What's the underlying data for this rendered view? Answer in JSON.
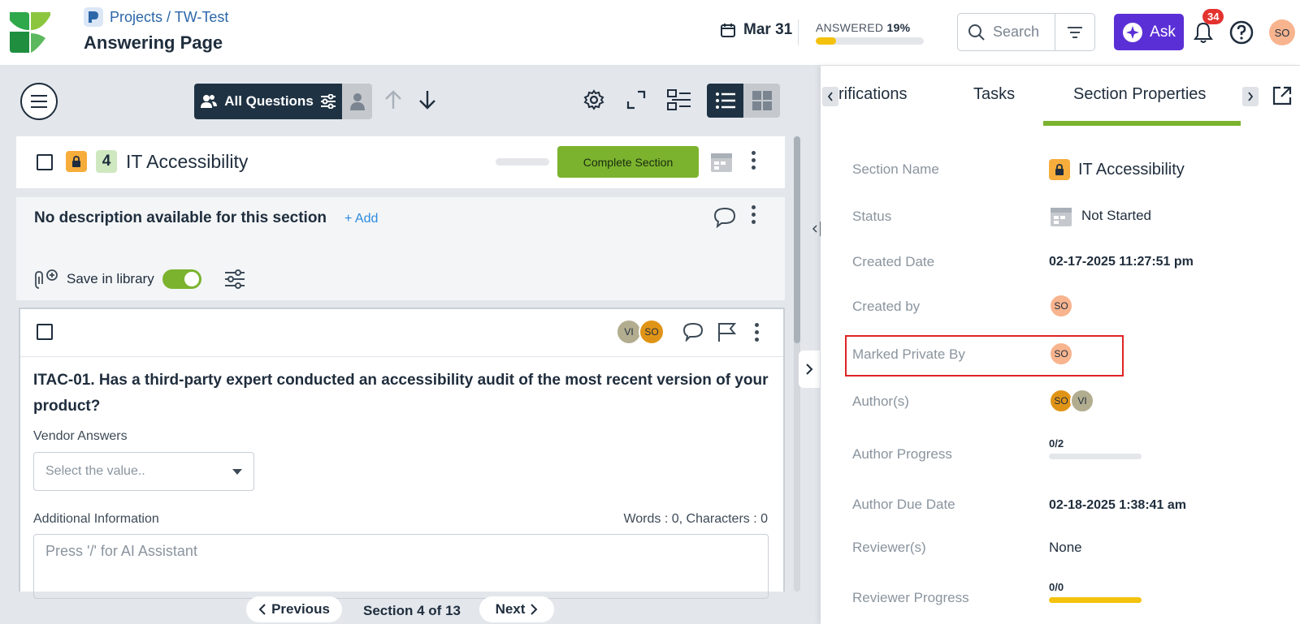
{
  "header": {
    "breadcrumb": "Projects / TW-Test",
    "title": "Answering Page",
    "date": "Mar 31",
    "answered_label": "ANSWERED",
    "answered_percent": "19%",
    "answered_fraction": 0.19,
    "search_placeholder": "Search",
    "ask_label": "Ask",
    "notification_count": "34",
    "user_initials": "SO"
  },
  "toolbar": {
    "filter_label": "All Questions"
  },
  "section": {
    "number": "4",
    "title": "IT Accessibility",
    "complete_label": "Complete Section",
    "description": "No description available for this section",
    "add_label": "+ Add",
    "save_library_label": "Save in library"
  },
  "question": {
    "avatars": [
      "VI",
      "SO"
    ],
    "text": "ITAC-01. Has a third-party expert conducted an accessibility audit of the most recent version of your product?",
    "vendor_label": "Vendor Answers",
    "select_placeholder": "Select the value..",
    "additional_label": "Additional Information",
    "word_count": "Words : 0, Characters : 0",
    "textarea_placeholder": "Press '/' for AI Assistant"
  },
  "footer": {
    "previous": "Previous",
    "section_count": "Section 4 of 13",
    "next": "Next"
  },
  "panel": {
    "tabs": [
      "rifications",
      "Tasks",
      "Section Properties"
    ],
    "active_tab": "Section Properties",
    "rows": {
      "section_name_label": "Section Name",
      "section_name_value": "IT Accessibility",
      "status_label": "Status",
      "status_value": "Not Started",
      "created_date_label": "Created Date",
      "created_date_value": "02-17-2025 11:27:51 pm",
      "created_by_label": "Created by",
      "created_by_value": "SO",
      "marked_private_label": "Marked Private By",
      "marked_private_value": "SO",
      "authors_label": "Author(s)",
      "authors_values": [
        "SO",
        "VI"
      ],
      "author_progress_label": "Author Progress",
      "author_progress_value": "0/2",
      "author_progress_fraction": 0,
      "author_due_label": "Author Due Date",
      "author_due_value": "02-18-2025 1:38:41 am",
      "reviewers_label": "Reviewer(s)",
      "reviewers_value": "None",
      "reviewer_progress_label": "Reviewer Progress",
      "reviewer_progress_value": "0/0",
      "reviewer_progress_fraction": 1
    }
  },
  "colors": {
    "accent_green": "#7bb32e",
    "ask_purple": "#5b2fd6",
    "progress_yellow": "#f4c20d",
    "highlight_red": "#e02424",
    "lock_orange": "#f6ad3c"
  }
}
